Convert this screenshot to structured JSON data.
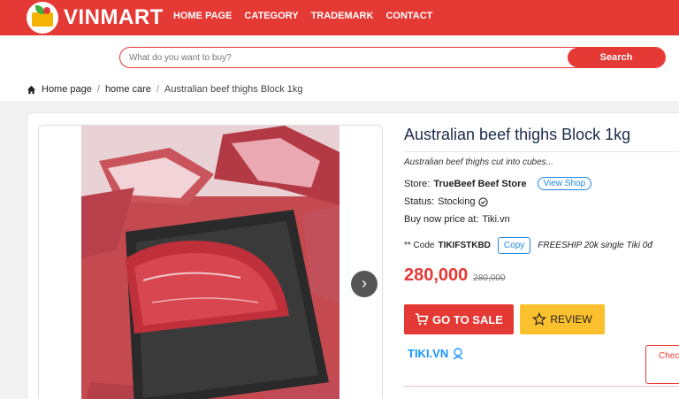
{
  "header": {
    "brand": "VINMART",
    "nav": [
      {
        "label": "HOME PAGE"
      },
      {
        "label": "CATEGORY"
      },
      {
        "label": "TRADEMARK"
      },
      {
        "label": "CONTACT"
      }
    ]
  },
  "search": {
    "placeholder": "What do you want to buy?",
    "button_label": "Search"
  },
  "breadcrumb": {
    "home": "Home page",
    "sep1": "/",
    "category": "home care",
    "sep2": "/",
    "current": "Australian beef thighs Block 1kg"
  },
  "product": {
    "title": "Australian beef thighs Block 1kg",
    "description": "Australian beef thighs cut into cubes...",
    "store_label": "Store:",
    "store_name": "TrueBeef Beef Store",
    "view_shop_label": "View Shop",
    "status_label": "Status:",
    "status_value": "Stocking",
    "buy_label": "Buy now price at:",
    "buy_site": "Tiki.vn",
    "code_label": "** Code",
    "code_value": "TIKIFSTKBD",
    "copy_label": "Copy",
    "promo_text": "FREESHIP 20k single Tiki 0đ",
    "price_now": "280,000",
    "price_old": "280,000",
    "sale_label": "GO TO SALE",
    "review_label": "REVIEW",
    "tiki_logo": "TIKI.VN",
    "check_label": "Chec",
    "next_label": "›"
  },
  "icons": {
    "home": "home-icon",
    "check_circle": "check-circle-icon",
    "cart": "cart-icon",
    "star": "star-icon",
    "chevron": "chevron-right-icon"
  },
  "colors": {
    "brand_red": "#e53935",
    "accent_blue": "#1e88e5",
    "review_yellow": "#fbc02d"
  }
}
